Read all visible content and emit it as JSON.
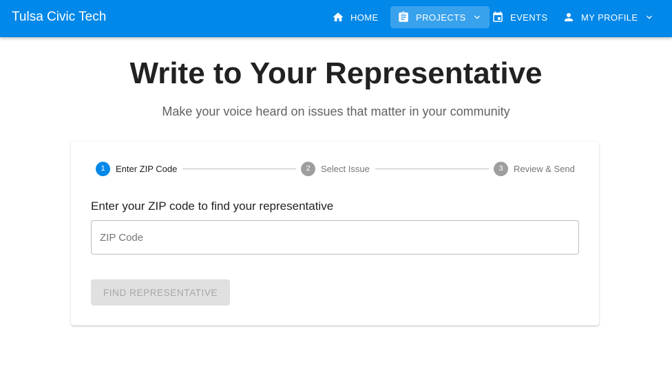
{
  "app": {
    "brand": "Tulsa Civic Tech"
  },
  "nav": {
    "home": {
      "label": "HOME",
      "icon": "home-icon"
    },
    "projects": {
      "label": "PROJECTS",
      "icon": "clipboard-icon",
      "active": true
    },
    "events": {
      "label": "EVENTS",
      "icon": "calendar-icon"
    },
    "profile": {
      "label": "MY PROFILE",
      "icon": "person-icon"
    }
  },
  "page": {
    "title": "Write to Your Representative",
    "subtitle": "Make your voice heard on issues that matter in your community"
  },
  "stepper": {
    "steps": [
      {
        "number": "1",
        "label": "Enter ZIP Code",
        "state": "active"
      },
      {
        "number": "2",
        "label": "Select Issue",
        "state": "inactive"
      },
      {
        "number": "3",
        "label": "Review & Send",
        "state": "inactive"
      }
    ]
  },
  "form": {
    "prompt": "Enter your ZIP code to find your representative",
    "zip_placeholder": "ZIP Code",
    "zip_value": "",
    "submit_label": "FIND REPRESENTATIVE",
    "submit_disabled": true
  },
  "colors": {
    "primary": "#0288e8",
    "step_inactive": "#9e9e9e",
    "button_disabled_bg": "#e0e0e0",
    "button_disabled_text": "#a6a6a6"
  }
}
